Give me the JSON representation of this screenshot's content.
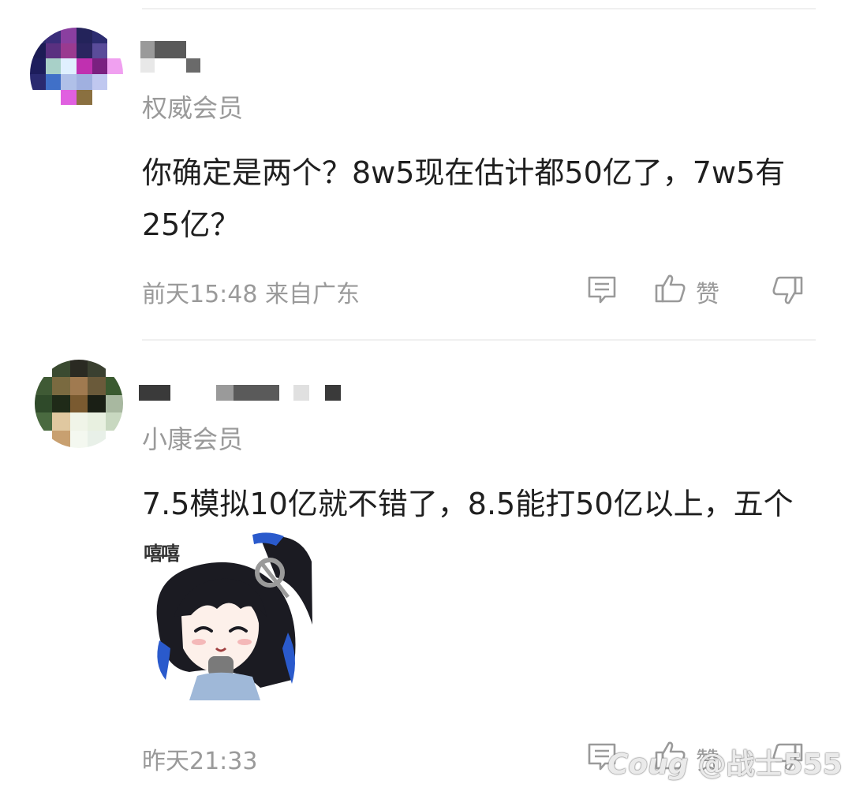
{
  "comments": [
    {
      "member_label": "权威会员",
      "content": "你确定是两个？8w5现在估计都50亿了，7w5有25亿？",
      "time_location": "前天15:48 来自广东",
      "like_label": "赞"
    },
    {
      "member_label": "小康会员",
      "content": "7.5模拟10亿就不错了，8.5能打50亿以上，五个",
      "sticker_text": "嘻嘻",
      "time_location": "昨天21:33",
      "like_label": "赞"
    }
  ],
  "watermark": "@战士555",
  "icons": {
    "reply": "comment-bubble-icon",
    "like": "thumbs-up-icon",
    "dislike": "thumbs-down-icon"
  },
  "colors": {
    "text": "#1f1f1f",
    "meta": "#9a9a9a",
    "divider": "#f0f0f0"
  }
}
